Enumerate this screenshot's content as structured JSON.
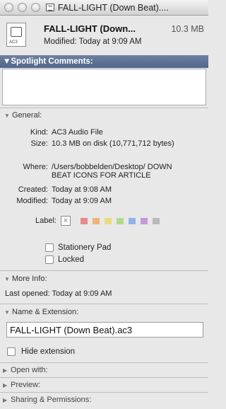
{
  "window": {
    "title": "FALL-LIGHT (Down Beat)...."
  },
  "header": {
    "file_name": "FALL-LIGHT (Down...",
    "file_size": "10.3 MB",
    "modified": "Modified: Today at 9:09 AM",
    "icon_tag": "AC3"
  },
  "spotlight": {
    "label": "▼Spotlight Comments:"
  },
  "general": {
    "label": "General:",
    "kind_label": "Kind:",
    "kind": "AC3 Audio File",
    "size_label": "Size:",
    "size": "10.3 MB on disk (10,771,712 bytes)",
    "where_label": "Where:",
    "where": "/Users/bobbelden/Desktop/ DOWN BEAT ICONS FOR ARTICLE",
    "created_label": "Created:",
    "created": "Today at 9:08 AM",
    "modified_label": "Modified:",
    "modified": "Today at 9:09 AM",
    "label_label": "Label:",
    "stationery_pad": "Stationery Pad",
    "locked": "Locked"
  },
  "more_info": {
    "label": "More Info:",
    "last_opened": "Last opened: Today at 9:09 AM"
  },
  "name_extension": {
    "label": "Name & Extension:",
    "value": "FALL-LIGHT (Down Beat).ac3",
    "hide_extension": "Hide extension"
  },
  "collapsed_sections": {
    "open_with": "Open with:",
    "preview": "Preview:",
    "sharing": "Sharing & Permissions:"
  },
  "label_colors": [
    "#e88a8a",
    "#efb27a",
    "#e9dc7f",
    "#b4d98c",
    "#8fb3e8",
    "#c49ad8",
    "#b9b9b9"
  ]
}
